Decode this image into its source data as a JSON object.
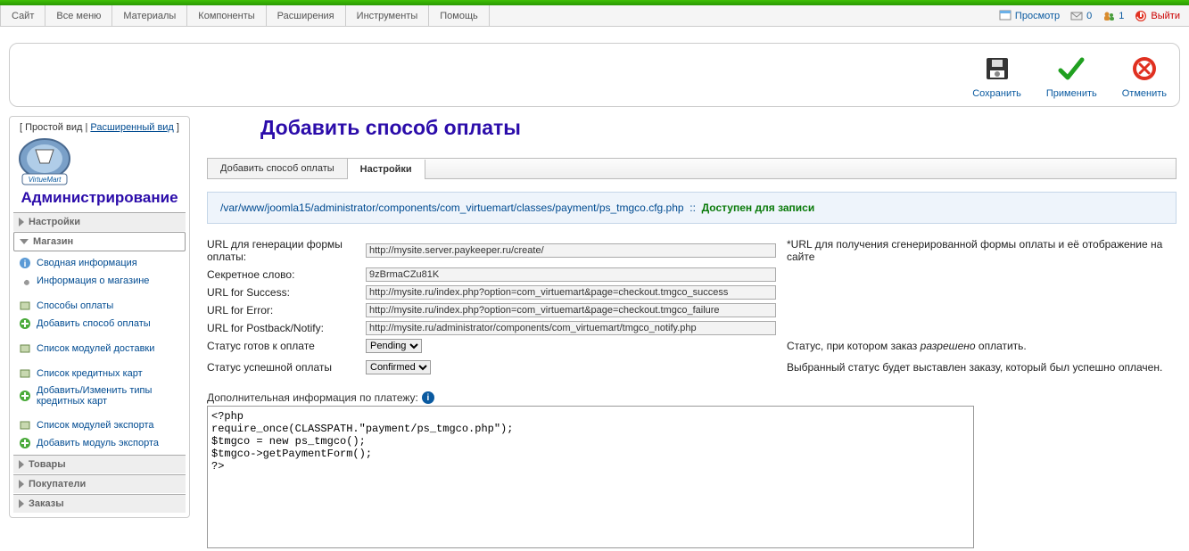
{
  "top_menu": [
    "Сайт",
    "Все меню",
    "Материалы",
    "Компоненты",
    "Расширения",
    "Инструменты",
    "Помощь"
  ],
  "top_right": {
    "preview": "Просмотр",
    "msg_count": "0",
    "user_count": "1",
    "logout": "Выйти"
  },
  "toolbar": {
    "save": "Сохранить",
    "apply": "Применить",
    "cancel": "Отменить"
  },
  "sidebar": {
    "view_simple": "Простой вид",
    "view_ext": "Расширенный вид",
    "title": "Администрирование",
    "sections": {
      "settings": "Настройки",
      "shop": "Магазин",
      "products": "Товары",
      "customers": "Покупатели",
      "orders": "Заказы"
    },
    "shop_items": [
      "Сводная информация",
      "Информация о магазине",
      "Способы оплаты",
      "Добавить способ оплаты",
      "Список модулей доставки",
      "Список кредитных карт",
      "Добавить/Изменить типы кредитных карт",
      "Список модулей экспорта",
      "Добавить модуль экспорта"
    ]
  },
  "page": {
    "title": "Добавить способ оплаты",
    "tabs": [
      "Добавить способ оплаты",
      "Настройки"
    ],
    "filepath": "/var/www/joomla15/administrator/components/com_virtuemart/classes/payment/ps_tmgco.cfg.php",
    "filepath_sep": "::",
    "filepath_status": "Доступен для записи"
  },
  "form": {
    "url_gen_label": "URL для генерации формы оплаты:",
    "url_gen_value": "http://mysite.server.paykeeper.ru/create/",
    "url_gen_note": "*URL для получения сгенерированной формы оплаты и её отображение на сайте",
    "secret_label": "Секретное слово:",
    "secret_value": "9zBrmaCZu81K",
    "url_success_label": "URL for Success:",
    "url_success_value": "http://mysite.ru/index.php?option=com_virtuemart&page=checkout.tmgco_success",
    "url_error_label": "URL for Error:",
    "url_error_value": "http://mysite.ru/index.php?option=com_virtuemart&page=checkout.tmgco_failure",
    "url_postback_label": "URL for Postback/Notify:",
    "url_postback_value": "http://mysite.ru/administrator/components/com_virtuemart/tmgco_notify.php",
    "status_ready_label": "Статус готов к оплате",
    "status_ready_value": "Pending",
    "status_ready_note_1": "Статус, при котором заказ ",
    "status_ready_note_em": "разрешено",
    "status_ready_note_2": " оплатить.",
    "status_success_label": "Статус успешной оплаты",
    "status_success_value": "Confirmed",
    "status_success_note": "Выбранный статус будет выставлен заказу, который был успешно оплачен.",
    "extra_label": "Дополнительная информация по платежу:",
    "code_value": "<?php\nrequire_once(CLASSPATH.\"payment/ps_tmgco.php\");\n$tmgco = new ps_tmgco();\n$tmgco->getPaymentForm();\n?>"
  }
}
